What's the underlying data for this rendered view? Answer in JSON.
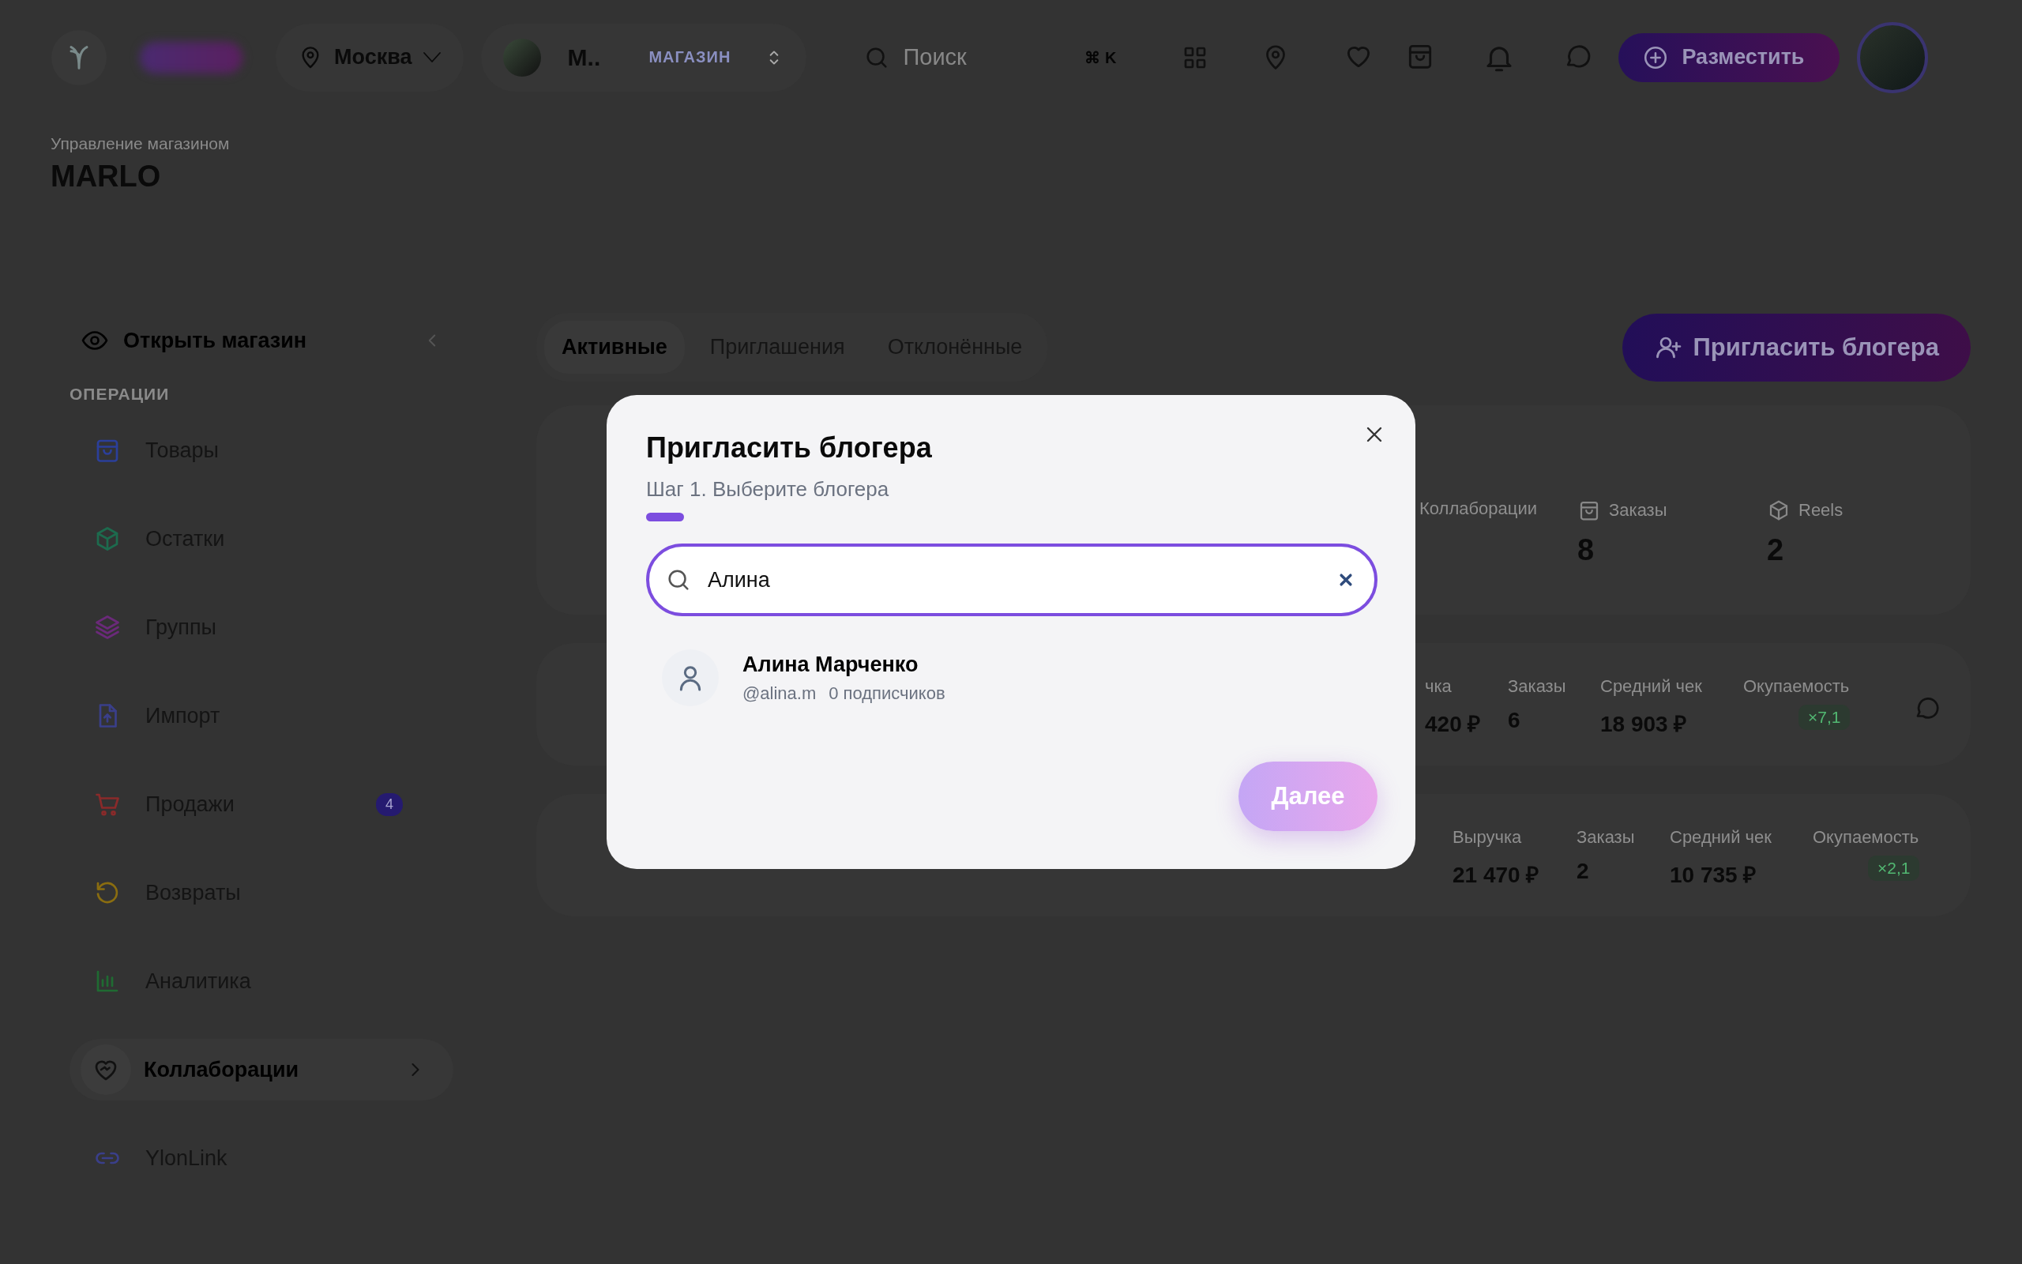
{
  "header": {
    "city": "Москва",
    "store": {
      "name": "М..",
      "tag": "МАГАЗИН"
    },
    "search": {
      "placeholder": "Поиск",
      "shortcut": "⌘ K"
    },
    "post_button": "Разместить"
  },
  "page": {
    "subtitle": "Управление магазином",
    "title": "MARLO"
  },
  "sidebar": {
    "open_store": "Открыть магазин",
    "section": "ОПЕРАЦИИ",
    "items": [
      {
        "label": "Товары",
        "color": "#2b3f9a",
        "selected": false
      },
      {
        "label": "Остатки",
        "color": "#1d6b4e",
        "selected": false
      },
      {
        "label": "Группы",
        "color": "#6b2a7a",
        "selected": false
      },
      {
        "label": "Импорт",
        "color": "#3a3f8a",
        "selected": false
      },
      {
        "label": "Продажи",
        "color": "#8a2a2a",
        "selected": false,
        "badge": "4"
      },
      {
        "label": "Возвраты",
        "color": "#8a6d10",
        "selected": false
      },
      {
        "label": "Аналитика",
        "color": "#1f6b32",
        "selected": false
      },
      {
        "label": "Коллаборации",
        "color": "#111111",
        "selected": true
      },
      {
        "label": "YlonLink",
        "color": "#3a3f8a",
        "selected": false
      }
    ]
  },
  "tabs": [
    {
      "label": "Активные",
      "selected": true
    },
    {
      "label": "Приглашения",
      "selected": false
    },
    {
      "label": "Отклонённые",
      "selected": false
    }
  ],
  "invite_button": "Пригласить блогера",
  "stats": [
    {
      "label": "Коллаборации"
    },
    {
      "label": "Заказы",
      "value": "8"
    },
    {
      "label": "Reels",
      "value": "2"
    }
  ],
  "rows": [
    {
      "metrics": [
        {
          "label": "чка",
          "value": "420 ₽"
        },
        {
          "label": "Заказы",
          "value": "6"
        },
        {
          "label": "Средний чек",
          "value": "18 903 ₽"
        },
        {
          "label": "Окупаемость",
          "badge": "×7,1"
        }
      ],
      "chat": true
    },
    {
      "metrics": [
        {
          "label": "Выручка",
          "value": "21 470 ₽"
        },
        {
          "label": "Заказы",
          "value": "2"
        },
        {
          "label": "Средний чек",
          "value": "10 735 ₽"
        },
        {
          "label": "Окупаемость",
          "badge": "×2,1"
        }
      ],
      "chat": false
    }
  ],
  "modal": {
    "title": "Пригласить блогера",
    "step": "Шаг 1. Выберите блогера",
    "search_value": "Алина",
    "results": [
      {
        "name": "Алина Марченко",
        "handle": "@alina.m",
        "followers": "0 подписчиков",
        "selected": false
      }
    ],
    "next_button": {
      "label": "Далее",
      "disabled": true
    }
  }
}
